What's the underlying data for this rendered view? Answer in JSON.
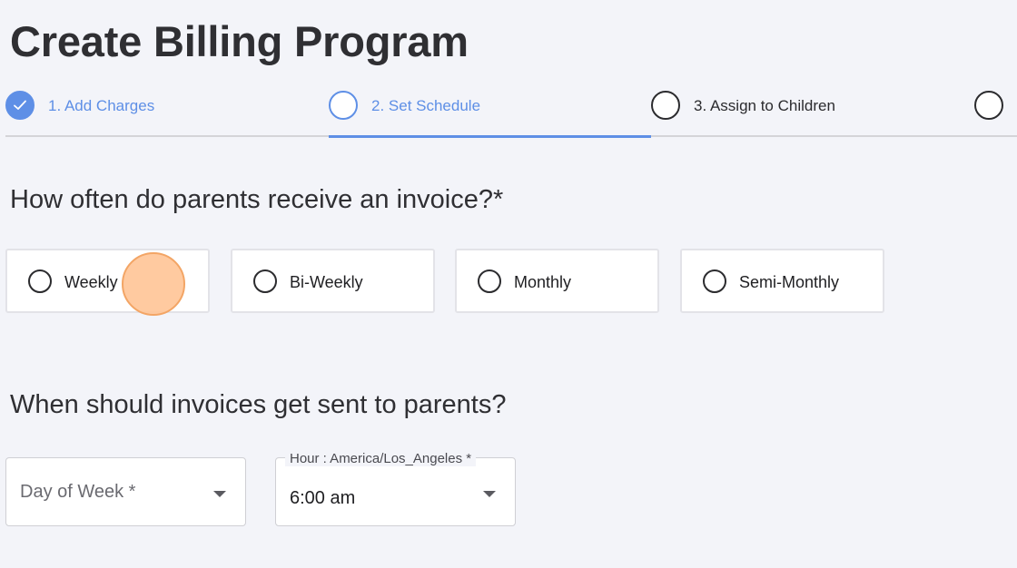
{
  "page": {
    "title": "Create Billing Program"
  },
  "stepper": {
    "steps": [
      {
        "label": "1. Add Charges",
        "state": "done"
      },
      {
        "label": "2. Set Schedule",
        "state": "active"
      },
      {
        "label": "3. Assign to Children",
        "state": "pending"
      },
      {
        "label": "",
        "state": "pending"
      }
    ],
    "accent_color": "#5e8fe6"
  },
  "frequency": {
    "question": "How often do parents receive an invoice?*",
    "options": [
      "Weekly",
      "Bi-Weekly",
      "Monthly",
      "Semi-Monthly"
    ]
  },
  "send_time": {
    "question": "When should invoices get sent to parents?",
    "day_select": {
      "placeholder": "Day of Week *"
    },
    "hour_select": {
      "label": "Hour : America/Los_Angeles *",
      "value": "6:00 am"
    }
  },
  "icons": {
    "done_step": "check-icon",
    "dropdown": "caret-down-icon"
  }
}
